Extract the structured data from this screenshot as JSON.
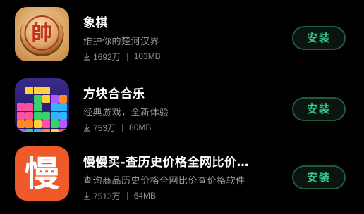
{
  "apps": [
    {
      "name": "象棋",
      "description": "维护你的楚河汉界",
      "downloads": "1692万",
      "size": "103MB",
      "install_label": "安装",
      "icon": "chinese-chess-icon",
      "icon_glyph": "帥"
    },
    {
      "name": "方块合合乐",
      "description": "经典游戏，全新体验",
      "downloads": "753万",
      "size": "80MB",
      "install_label": "安装",
      "icon": "block-puzzle-icon"
    },
    {
      "name": "慢慢买-查历史价格全网比价…",
      "description": "查询商品历史价格全网比价查价格软件",
      "downloads": "7513万",
      "size": "64MB",
      "install_label": "安装",
      "icon": "manmanmai-icon",
      "icon_glyph": "慢"
    }
  ],
  "colors": {
    "background": "#000000",
    "install_text": "#36c98a",
    "install_border": "#1f5a40",
    "secondary_text": "#9a9a9a"
  }
}
